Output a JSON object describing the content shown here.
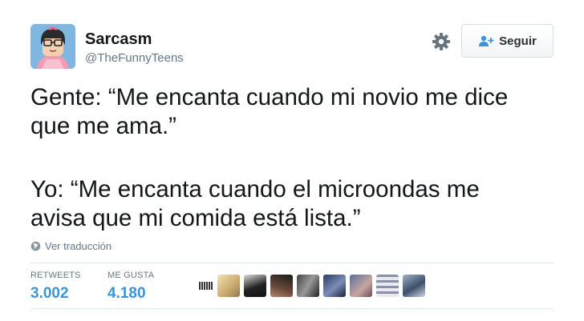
{
  "user": {
    "name": "Sarcasm",
    "handle": "@TheFunnyTeens"
  },
  "actions": {
    "follow_label": "Seguir"
  },
  "tweet": {
    "lines_1": [
      "Gente: “Me encanta cuando mi novio me dice",
      "que me ama.”"
    ],
    "lines_2": [
      "Yo: “Me encanta cuando el microondas me",
      "avisa que mi comida está lista.”"
    ]
  },
  "translate_label": "Ver traducción",
  "stats": {
    "retweets_label": "RETWEETS",
    "retweets_value": "3.002",
    "likes_label": "ME GUSTA",
    "likes_value": "4.180"
  },
  "icons": {
    "settings": "gear-icon",
    "follow": "add-user-icon",
    "translate": "globe-icon"
  },
  "colors": {
    "accent": "#3b94d9",
    "muted": "#657786",
    "text": "#14171a",
    "border": "#e1e8ed"
  }
}
